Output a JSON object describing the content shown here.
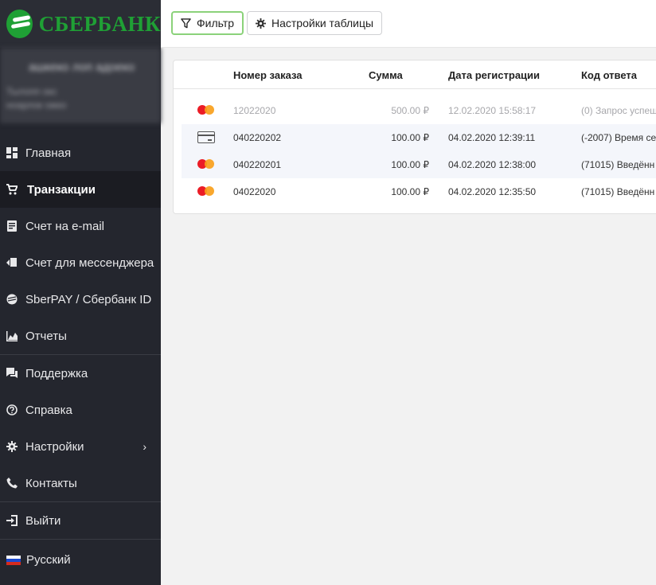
{
  "brand": {
    "logo_text": "СБЕРБАНК",
    "color": "#1fa035"
  },
  "user": {
    "name": "ашкеко лоп адоеко",
    "line1": "Тылопп окс",
    "line2": "ноарлок ожко"
  },
  "sidebar": {
    "items": [
      {
        "label": "Главная",
        "icon": "dashboard-icon"
      },
      {
        "label": "Транзакции",
        "icon": "cart-icon"
      },
      {
        "label": "Счет на e-mail",
        "icon": "invoice-icon"
      },
      {
        "label": "Счет для мессенджера",
        "icon": "messenger-icon"
      },
      {
        "label": "SberPAY / Сбербанк ID",
        "icon": "sber-icon"
      },
      {
        "label": "Отчеты",
        "icon": "chart-icon"
      },
      {
        "label": "Поддержка",
        "icon": "support-icon"
      },
      {
        "label": "Справка",
        "icon": "help-icon"
      },
      {
        "label": "Настройки",
        "icon": "gear-icon"
      },
      {
        "label": "Контакты",
        "icon": "phone-icon"
      },
      {
        "label": "Выйти",
        "icon": "logout-icon"
      },
      {
        "label": "Русский",
        "icon": "flag-ru-icon"
      }
    ],
    "active": "Транзакции"
  },
  "toolbar": {
    "filter_label": "Фильтр",
    "settings_label": "Настройки таблицы"
  },
  "table": {
    "columns": [
      "Номер заказа",
      "Сумма",
      "Дата регистрации",
      "Код ответа"
    ],
    "rows": [
      {
        "card": "mastercard-icon",
        "order": "12022020",
        "sum": "500.00 ₽",
        "date": "12.02.2020 15:58:17",
        "code": "(0) Запрос успеш"
      },
      {
        "card": "card-icon",
        "order": "040220202",
        "sum": "100.00 ₽",
        "date": "04.02.2020 12:39:11",
        "code": "(-2007) Время се"
      },
      {
        "card": "mastercard-icon",
        "order": "040220201",
        "sum": "100.00 ₽",
        "date": "04.02.2020 12:38:00",
        "code": "(71015) Введённ"
      },
      {
        "card": "mastercard-icon",
        "order": "04022020",
        "sum": "100.00 ₽",
        "date": "04.02.2020 12:35:50",
        "code": "(71015) Введённ"
      }
    ]
  }
}
